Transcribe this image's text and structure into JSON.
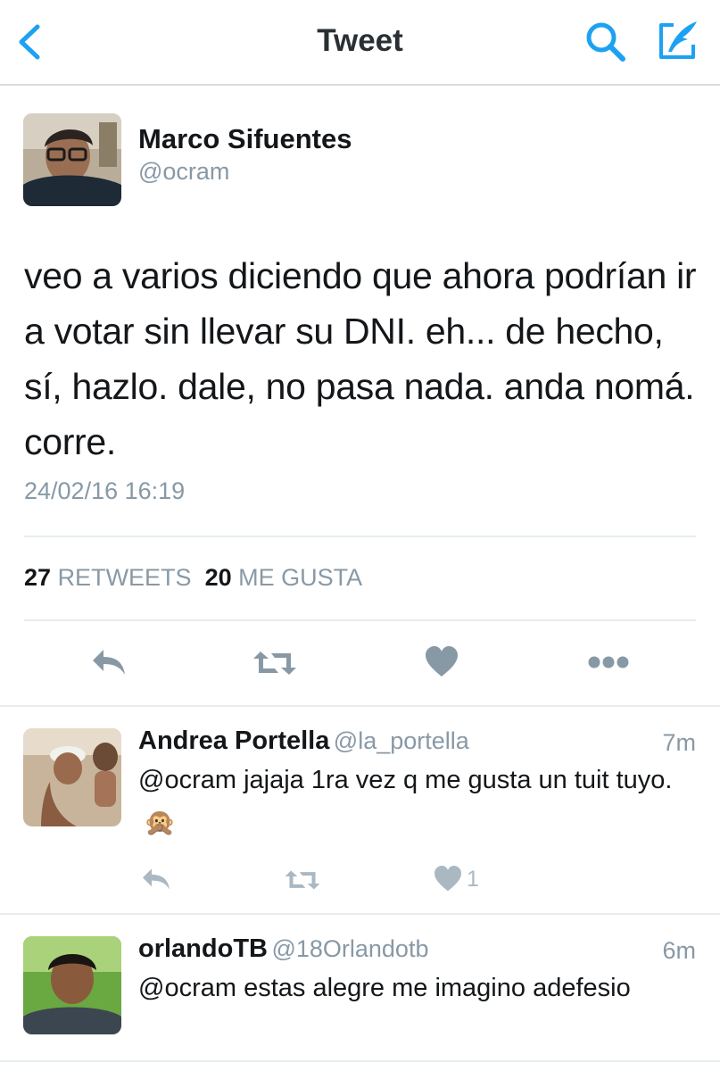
{
  "nav": {
    "title": "Tweet",
    "back_icon": "chevron-left-icon",
    "search_icon": "search-icon",
    "compose_icon": "compose-icon",
    "accent": "#1da1f2"
  },
  "tweet": {
    "author_name": "Marco Sifuentes",
    "author_handle": "@ocram",
    "text": "veo a varios diciendo que ahora podrían ir a votar sin llevar su DNI. eh... de hecho, sí, hazlo. dale, no pasa nada. anda nomá. corre.",
    "timestamp": "24/02/16 16:19",
    "retweets_count": "27",
    "retweets_label": "RETWEETS",
    "likes_count": "20",
    "likes_label": "ME GUSTA"
  },
  "replies": [
    {
      "name": "Andrea Portella",
      "handle": "@la_portella",
      "time": "7m",
      "text": "@ocram jajaja 1ra vez q me gusta un tuit tuyo.",
      "emoji": "🙊",
      "likes": "1"
    },
    {
      "name": "orlandoTB",
      "handle": "@18Orlandotb",
      "time": "6m",
      "text": "@ocram estas alegre me imagino adefesio"
    }
  ],
  "colors": {
    "text": "#14171a",
    "secondary": "#8899a6",
    "icon": "#8899a6",
    "divider": "#e6ecf0"
  }
}
